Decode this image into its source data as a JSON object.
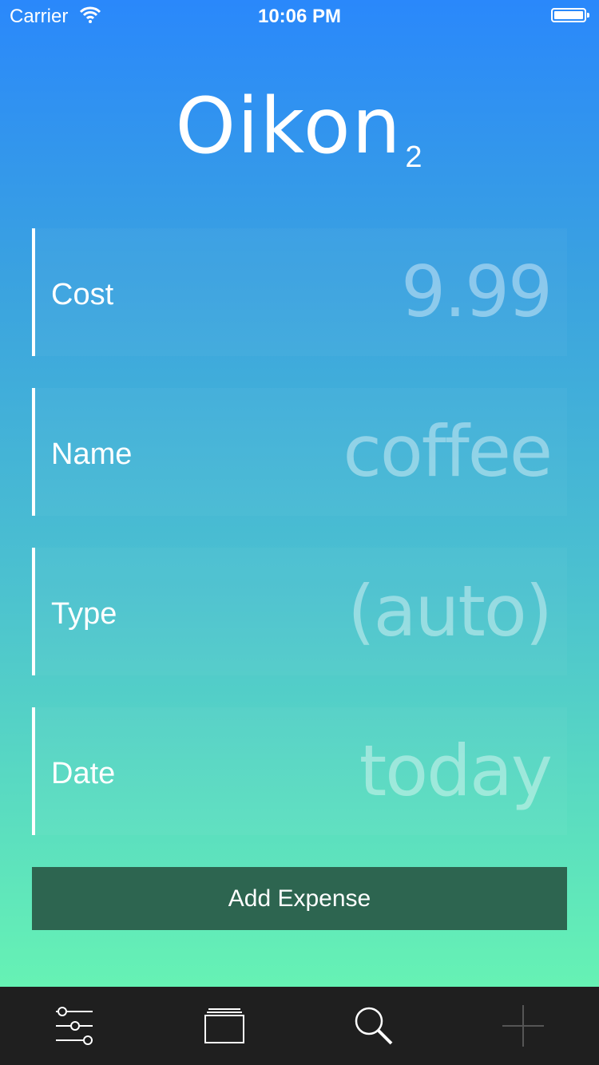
{
  "status_bar": {
    "carrier": "Carrier",
    "time": "10:06 PM"
  },
  "app": {
    "title": "Oikon",
    "subscript": "2"
  },
  "form": {
    "rows": [
      {
        "label": "Cost",
        "value": "9.99"
      },
      {
        "label": "Name",
        "value": "coffee"
      },
      {
        "label": "Type",
        "value": "(auto)"
      },
      {
        "label": "Date",
        "value": "today"
      }
    ]
  },
  "actions": {
    "add_expense": "Add Expense"
  },
  "tab_bar": {
    "items": [
      {
        "icon": "sliders-icon"
      },
      {
        "icon": "stack-icon"
      },
      {
        "icon": "search-icon"
      },
      {
        "icon": "plus-icon"
      }
    ]
  },
  "colors": {
    "gradient_top": "#2a88fb",
    "gradient_bottom": "#66f2b4",
    "button": "#2d6550",
    "tab_bar": "#1f1f1f"
  }
}
